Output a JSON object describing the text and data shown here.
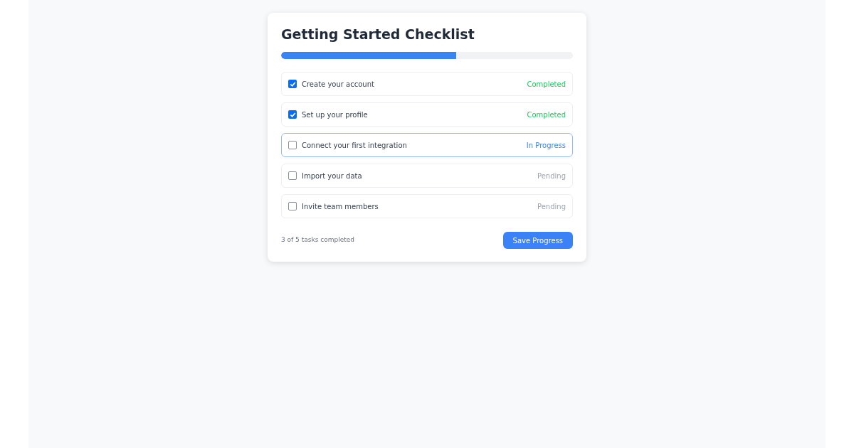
{
  "title": "Getting Started Checklist",
  "progress": {
    "level": 0.6
  },
  "tasks": [
    {
      "label": "Create your account",
      "checked": true,
      "kind": "completed",
      "status": "Completed"
    },
    {
      "label": "Set up your profile",
      "checked": true,
      "kind": "completed",
      "status": "Completed"
    },
    {
      "label": "Connect your first integration",
      "checked": false,
      "kind": "in_progress",
      "status": "In Progress"
    },
    {
      "label": "Import your data",
      "checked": false,
      "kind": "pending",
      "status": "Pending"
    },
    {
      "label": "Invite team members",
      "checked": false,
      "kind": "pending",
      "status": "Pending"
    }
  ],
  "summary": "3 of 5 tasks completed",
  "save_button": "Save Progress"
}
